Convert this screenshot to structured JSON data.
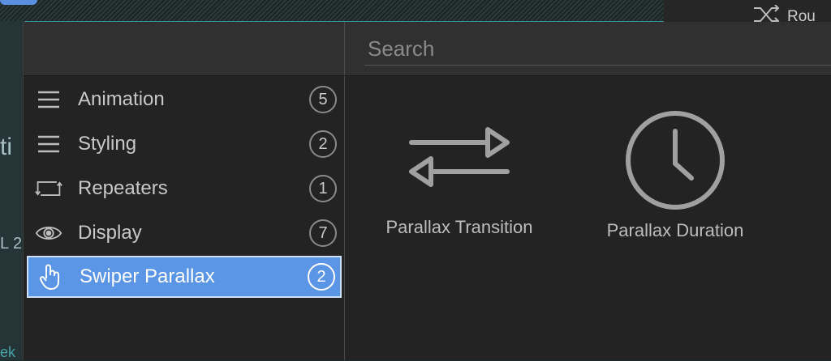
{
  "background": {
    "route_label": "Rou",
    "fragments": [
      "ti",
      "L 2",
      "ek"
    ]
  },
  "search": {
    "placeholder": "Search",
    "value": ""
  },
  "sidebar": {
    "items": [
      {
        "label": "Animation",
        "count": "5",
        "icon": "list-icon"
      },
      {
        "label": "Styling",
        "count": "2",
        "icon": "list-icon"
      },
      {
        "label": "Repeaters",
        "count": "1",
        "icon": "repeat-icon"
      },
      {
        "label": "Display",
        "count": "7",
        "icon": "eye-icon"
      },
      {
        "label": "Swiper Parallax",
        "count": "2",
        "icon": "hand-pointer-icon",
        "selected": true
      }
    ]
  },
  "content": {
    "tiles": [
      {
        "label": "Parallax Transition",
        "icon": "swap-arrows-icon"
      },
      {
        "label": "Parallax Duration",
        "icon": "clock-icon"
      }
    ]
  },
  "colors": {
    "selected": "#5b95e6",
    "panel": "#232323",
    "header": "#303030"
  }
}
